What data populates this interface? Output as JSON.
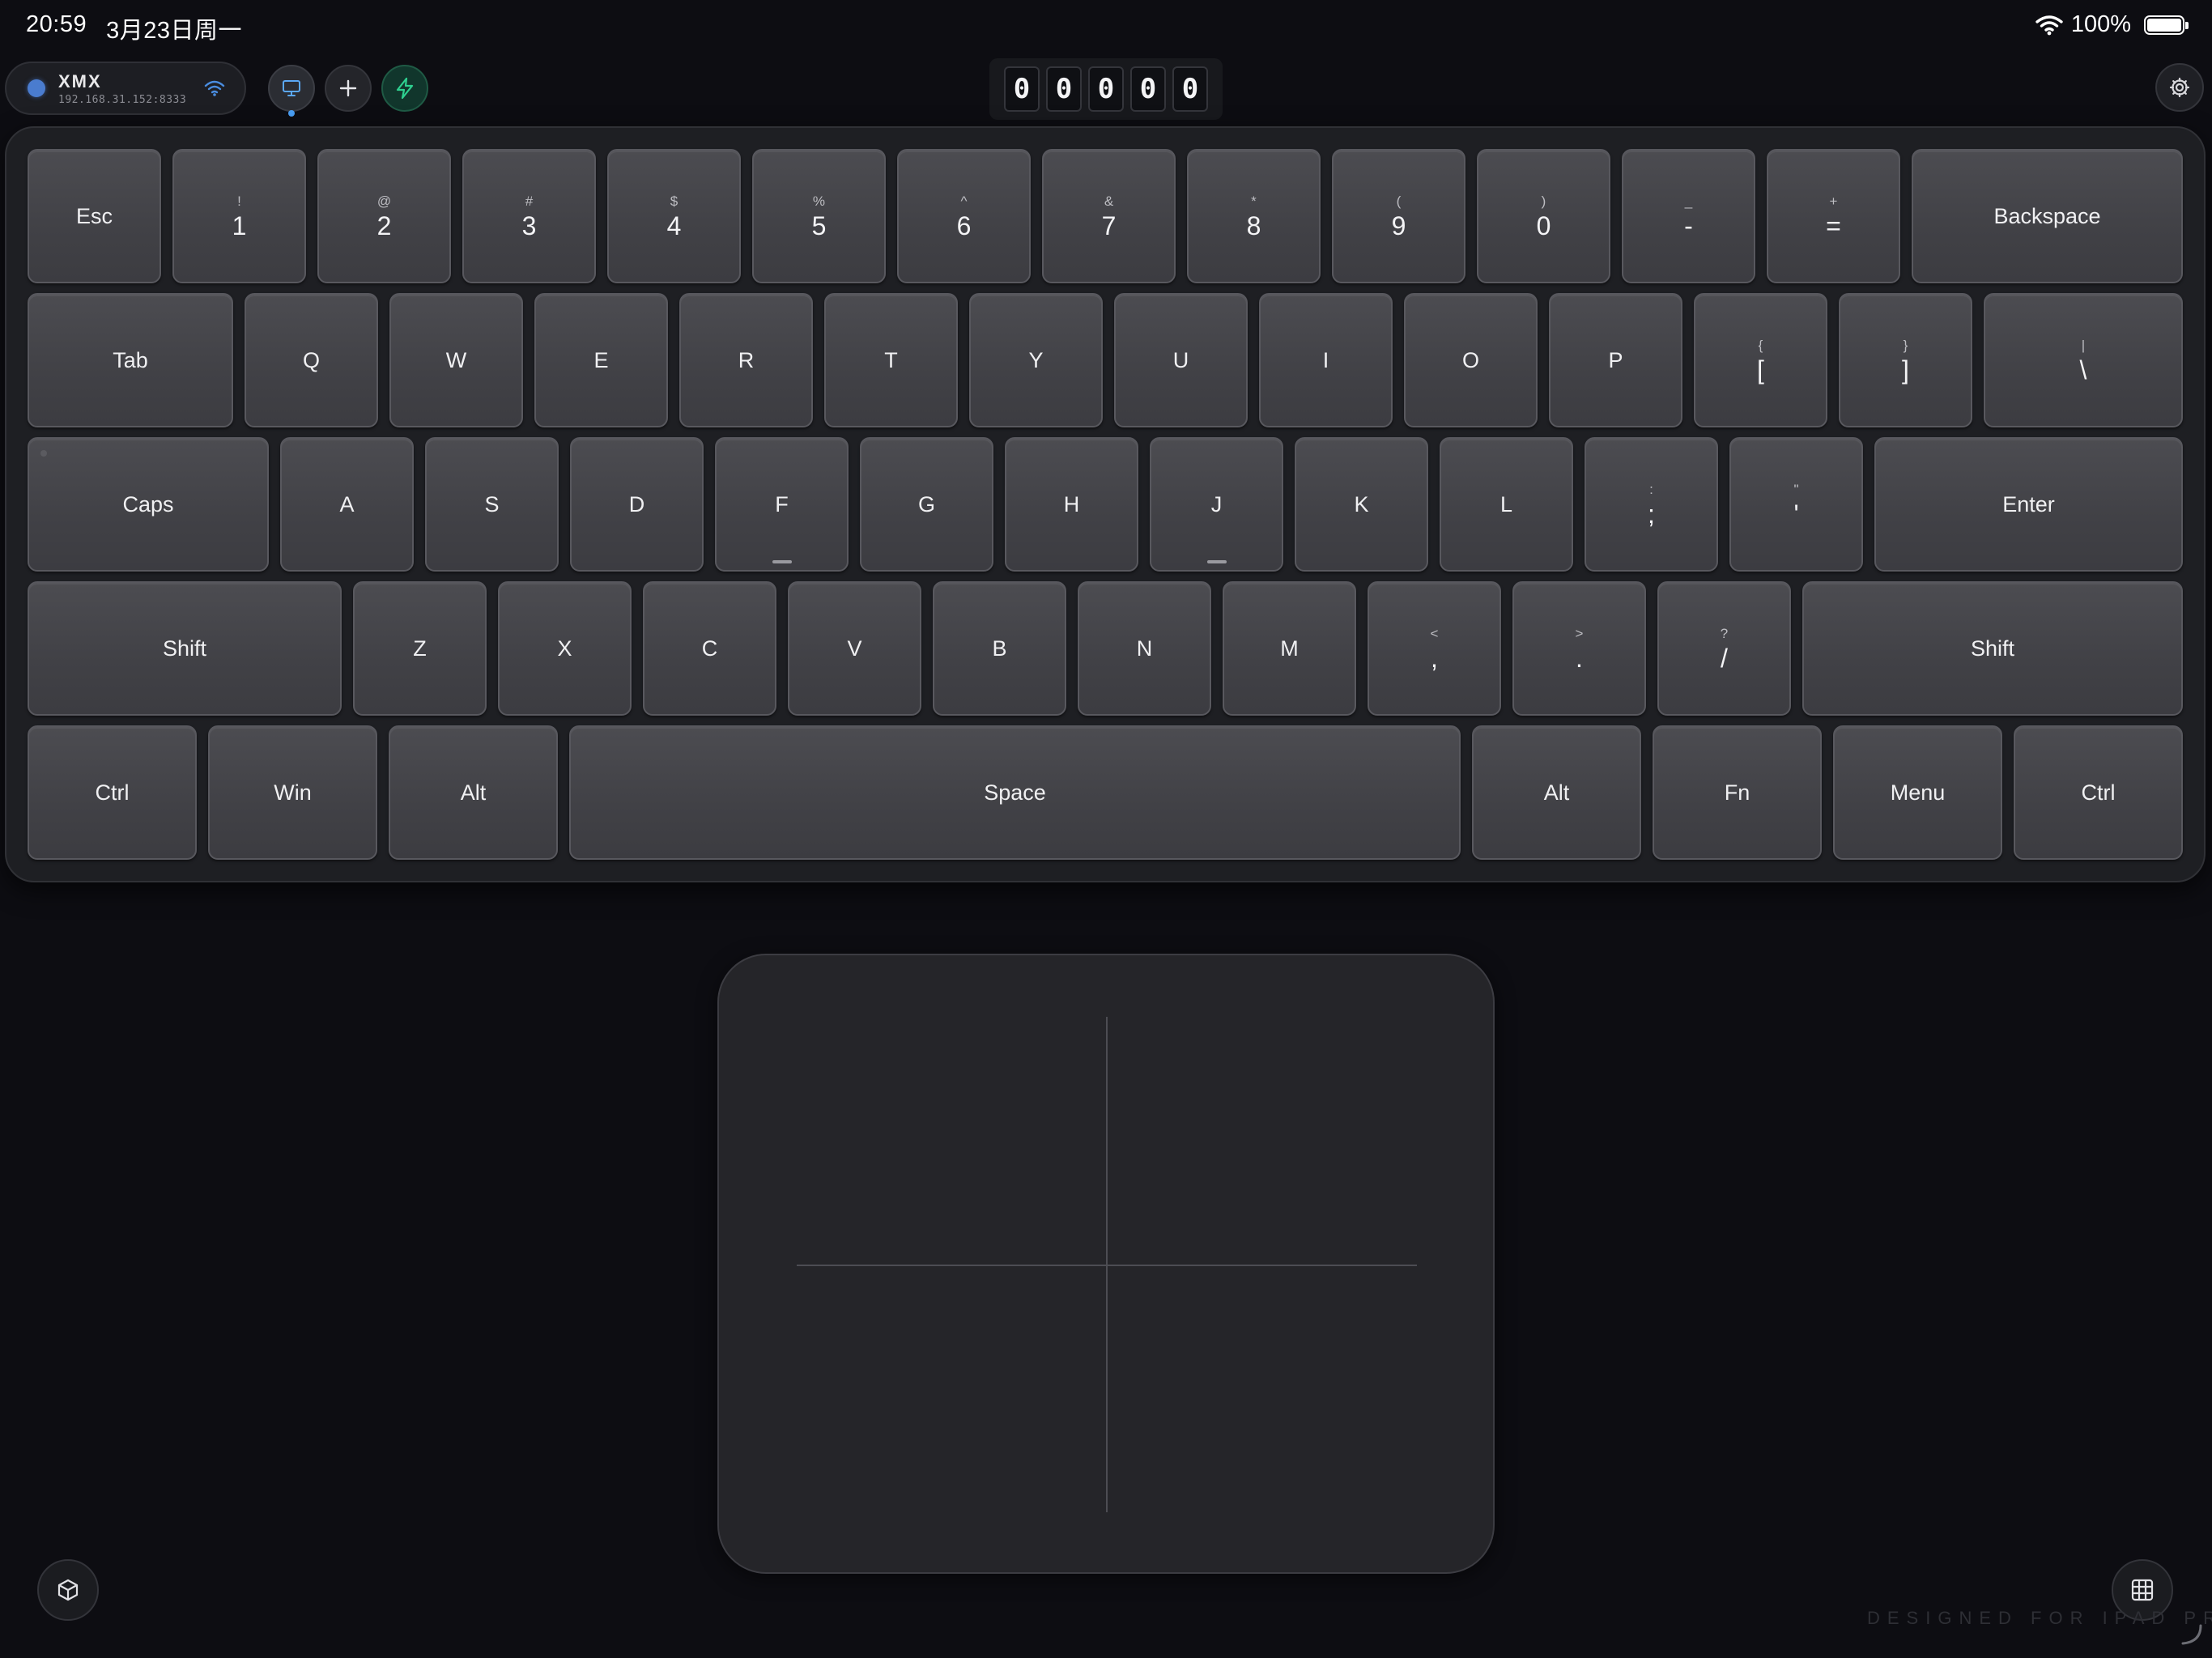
{
  "status_bar": {
    "time": "20:59",
    "date": "3月23日周一",
    "battery": "100%"
  },
  "connection": {
    "name": "XMX",
    "ip": "192.168.31.152:8333"
  },
  "counter": {
    "digits": [
      "0",
      "0",
      "0",
      "0",
      "0"
    ]
  },
  "keyboard": {
    "row1": {
      "esc": "Esc",
      "k1s": "!",
      "k1": "1",
      "k2s": "@",
      "k2": "2",
      "k3s": "#",
      "k3": "3",
      "k4s": "$",
      "k4": "4",
      "k5s": "%",
      "k5": "5",
      "k6s": "^",
      "k6": "6",
      "k7s": "&",
      "k7": "7",
      "k8s": "*",
      "k8": "8",
      "k9s": "(",
      "k9": "9",
      "k0s": ")",
      "k0": "0",
      "minus_s": "_",
      "minus": "-",
      "equal_s": "+",
      "equal": "=",
      "backspace": "Backspace"
    },
    "row2": {
      "tab": "Tab",
      "q": "Q",
      "w": "W",
      "e": "E",
      "r": "R",
      "t": "T",
      "y": "Y",
      "u": "U",
      "i": "I",
      "o": "O",
      "p": "P",
      "lbr_s": "{",
      "lbr": "[",
      "rbr_s": "}",
      "rbr": "]",
      "bsl_s": "|",
      "bsl": "\\"
    },
    "row3": {
      "caps": "Caps",
      "a": "A",
      "s": "S",
      "d": "D",
      "f": "F",
      "g": "G",
      "h": "H",
      "j": "J",
      "k": "K",
      "l": "L",
      "semi_s": ":",
      "semi": ";",
      "quote_s": "\"",
      "quote": "'",
      "enter": "Enter"
    },
    "row4": {
      "lshift": "Shift",
      "z": "Z",
      "x": "X",
      "c": "C",
      "v": "V",
      "b": "B",
      "n": "N",
      "m": "M",
      "comma_s": "<",
      "comma": ",",
      "period_s": ">",
      "period": ".",
      "slash_s": "?",
      "slash": "/",
      "rshift": "Shift"
    },
    "row5": {
      "lctrl": "Ctrl",
      "win": "Win",
      "lalt": "Alt",
      "space": "Space",
      "ralt": "Alt",
      "fn": "Fn",
      "menu": "Menu",
      "rctrl": "Ctrl"
    }
  },
  "footer": {
    "text": "DESIGNED FOR IPAD PRO"
  },
  "icons": {
    "wifi": "wifi-icon",
    "monitor": "monitor-icon",
    "plus": "plus-icon",
    "bolt": "bolt-icon",
    "settings": "gear-icon",
    "cube": "cube-icon",
    "grid": "grid-icon"
  },
  "colors": {
    "background": "#0d0d12",
    "key": "#444449",
    "accent_blue": "#4a9ff5",
    "accent_green": "#2ecf8f"
  }
}
